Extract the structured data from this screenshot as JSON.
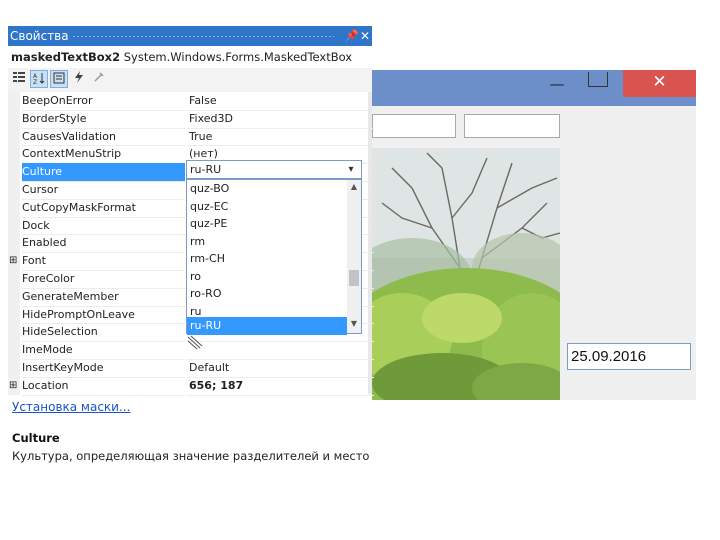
{
  "panel": {
    "title": "Свойства",
    "pin_glyph": "📌",
    "close_glyph": "✕",
    "object_name": "maskedTextBox2",
    "object_type": "System.Windows.Forms.MaskedTextBox",
    "toolbar_icons": [
      "categorized-icon",
      "alphabetical-icon",
      "properties-icon",
      "events-icon",
      "property-pages-icon"
    ]
  },
  "properties": [
    {
      "name": "BeepOnError",
      "value": "False",
      "expandable": false
    },
    {
      "name": "BorderStyle",
      "value": "Fixed3D",
      "expandable": false
    },
    {
      "name": "CausesValidation",
      "value": "True",
      "expandable": false
    },
    {
      "name": "ContextMenuStrip",
      "value": "(нет)",
      "expandable": false
    },
    {
      "name": "Culture",
      "value": "ru-RU",
      "expandable": false,
      "selected": true
    },
    {
      "name": "Cursor",
      "value": "",
      "expandable": false
    },
    {
      "name": "CutCopyMaskFormat",
      "value": "",
      "expandable": false
    },
    {
      "name": "Dock",
      "value": "",
      "expandable": false
    },
    {
      "name": "Enabled",
      "value": "",
      "expandable": false
    },
    {
      "name": "Font",
      "value": "",
      "expandable": true
    },
    {
      "name": "ForeColor",
      "value": "",
      "expandable": false
    },
    {
      "name": "GenerateMember",
      "value": "",
      "expandable": false
    },
    {
      "name": "HidePromptOnLeave",
      "value": "",
      "expandable": false
    },
    {
      "name": "HideSelection",
      "value": "",
      "expandable": false
    },
    {
      "name": "ImeMode",
      "value": "",
      "expandable": false
    },
    {
      "name": "InsertKeyMode",
      "value": "Default",
      "expandable": false
    },
    {
      "name": "Location",
      "value": "656; 187",
      "expandable": true,
      "bold": true
    }
  ],
  "culture_dropdown": {
    "current": "ru-RU",
    "options": [
      "quz-BO",
      "quz-EC",
      "quz-PE",
      "rm",
      "rm-CH",
      "ro",
      "ro-RO",
      "ru",
      "ru-RU"
    ],
    "selected_index": 8
  },
  "mask_link": "Установка маски...",
  "description": {
    "title": "Culture",
    "text": "Культура, определяющая значение разделителей и местозапол..."
  },
  "form": {
    "close_glyph": "✕",
    "minimize_glyph": "—",
    "date_value": "25.09.2016"
  },
  "colors": {
    "title_bar": "#2f75c9",
    "selection": "#3399ff",
    "form_title": "#6d8fc9",
    "form_close": "#d9534f"
  }
}
